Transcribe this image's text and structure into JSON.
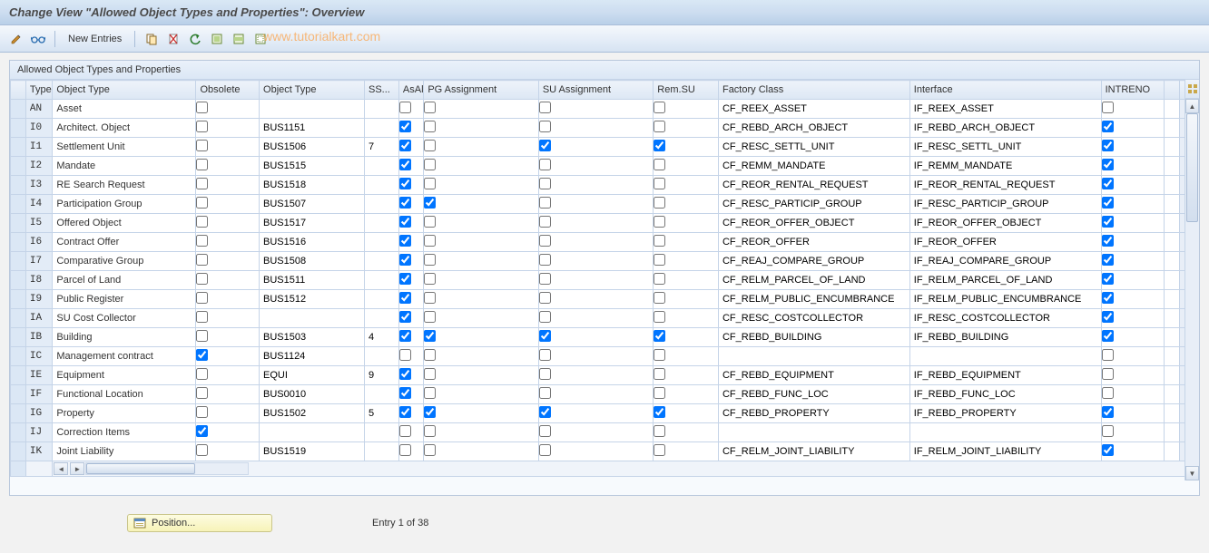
{
  "title": "Change View \"Allowed Object Types and Properties\": Overview",
  "watermark": "www.tutorialkart.com",
  "toolbar": {
    "new_entries": "New Entries"
  },
  "panel": {
    "header": "Allowed Object Types and Properties"
  },
  "columns": {
    "type": "Type",
    "object_type": "Object Type",
    "obsolete": "Obsolete",
    "object_type2": "Object Type",
    "ss": "SS...",
    "asal": "AsAl",
    "pg": "PG Assignment",
    "su": "SU Assignment",
    "remsu": "Rem.SU",
    "factory": "Factory Class",
    "interface": "Interface",
    "intreno": "INTRENO"
  },
  "rows": [
    {
      "type": "AN",
      "name": "Asset",
      "obsolete": false,
      "bus": "",
      "ss": "",
      "asal": false,
      "pg": false,
      "su": false,
      "remsu": false,
      "factory": "CF_REEX_ASSET",
      "iface": "IF_REEX_ASSET",
      "intreno": false
    },
    {
      "type": "I0",
      "name": "Architect. Object",
      "obsolete": false,
      "bus": "BUS1151",
      "ss": "",
      "asal": true,
      "pg": false,
      "su": false,
      "remsu": false,
      "factory": "CF_REBD_ARCH_OBJECT",
      "iface": "IF_REBD_ARCH_OBJECT",
      "intreno": true
    },
    {
      "type": "I1",
      "name": "Settlement Unit",
      "obsolete": false,
      "bus": "BUS1506",
      "ss": "7",
      "asal": true,
      "pg": false,
      "su": true,
      "remsu": true,
      "factory": "CF_RESC_SETTL_UNIT",
      "iface": "IF_RESC_SETTL_UNIT",
      "intreno": true
    },
    {
      "type": "I2",
      "name": "Mandate",
      "obsolete": false,
      "bus": "BUS1515",
      "ss": "",
      "asal": true,
      "pg": false,
      "su": false,
      "remsu": false,
      "factory": "CF_REMM_MANDATE",
      "iface": "IF_REMM_MANDATE",
      "intreno": true
    },
    {
      "type": "I3",
      "name": "RE Search Request",
      "obsolete": false,
      "bus": "BUS1518",
      "ss": "",
      "asal": true,
      "pg": false,
      "su": false,
      "remsu": false,
      "factory": "CF_REOR_RENTAL_REQUEST",
      "iface": "IF_REOR_RENTAL_REQUEST",
      "intreno": true
    },
    {
      "type": "I4",
      "name": "Participation Group",
      "obsolete": false,
      "bus": "BUS1507",
      "ss": "",
      "asal": true,
      "pg": true,
      "su": false,
      "remsu": false,
      "factory": "CF_RESC_PARTICIP_GROUP",
      "iface": "IF_RESC_PARTICIP_GROUP",
      "intreno": true
    },
    {
      "type": "I5",
      "name": "Offered Object",
      "obsolete": false,
      "bus": "BUS1517",
      "ss": "",
      "asal": true,
      "pg": false,
      "su": false,
      "remsu": false,
      "factory": "CF_REOR_OFFER_OBJECT",
      "iface": "IF_REOR_OFFER_OBJECT",
      "intreno": true
    },
    {
      "type": "I6",
      "name": "Contract Offer",
      "obsolete": false,
      "bus": "BUS1516",
      "ss": "",
      "asal": true,
      "pg": false,
      "su": false,
      "remsu": false,
      "factory": "CF_REOR_OFFER",
      "iface": "IF_REOR_OFFER",
      "intreno": true
    },
    {
      "type": "I7",
      "name": "Comparative Group",
      "obsolete": false,
      "bus": "BUS1508",
      "ss": "",
      "asal": true,
      "pg": false,
      "su": false,
      "remsu": false,
      "factory": "CF_REAJ_COMPARE_GROUP",
      "iface": "IF_REAJ_COMPARE_GROUP",
      "intreno": true
    },
    {
      "type": "I8",
      "name": "Parcel of Land",
      "obsolete": false,
      "bus": "BUS1511",
      "ss": "",
      "asal": true,
      "pg": false,
      "su": false,
      "remsu": false,
      "factory": "CF_RELM_PARCEL_OF_LAND",
      "iface": "IF_RELM_PARCEL_OF_LAND",
      "intreno": true
    },
    {
      "type": "I9",
      "name": "Public Register",
      "obsolete": false,
      "bus": "BUS1512",
      "ss": "",
      "asal": true,
      "pg": false,
      "su": false,
      "remsu": false,
      "factory": "CF_RELM_PUBLIC_ENCUMBRANCE",
      "iface": "IF_RELM_PUBLIC_ENCUMBRANCE",
      "intreno": true
    },
    {
      "type": "IA",
      "name": "SU Cost Collector",
      "obsolete": false,
      "bus": "",
      "ss": "",
      "asal": true,
      "pg": false,
      "su": false,
      "remsu": false,
      "factory": "CF_RESC_COSTCOLLECTOR",
      "iface": "IF_RESC_COSTCOLLECTOR",
      "intreno": true
    },
    {
      "type": "IB",
      "name": "Building",
      "obsolete": false,
      "bus": "BUS1503",
      "ss": "4",
      "asal": true,
      "pg": true,
      "su": true,
      "remsu": true,
      "factory": "CF_REBD_BUILDING",
      "iface": "IF_REBD_BUILDING",
      "intreno": true
    },
    {
      "type": "IC",
      "name": "Management contract",
      "obsolete": true,
      "bus": "BUS1124",
      "ss": "",
      "asal": false,
      "pg": false,
      "su": false,
      "remsu": false,
      "factory": "",
      "iface": "",
      "intreno": false
    },
    {
      "type": "IE",
      "name": "Equipment",
      "obsolete": false,
      "bus": "EQUI",
      "ss": "9",
      "asal": true,
      "pg": false,
      "su": false,
      "remsu": false,
      "factory": "CF_REBD_EQUIPMENT",
      "iface": "IF_REBD_EQUIPMENT",
      "intreno": false
    },
    {
      "type": "IF",
      "name": "Functional Location",
      "obsolete": false,
      "bus": "BUS0010",
      "ss": "",
      "asal": true,
      "pg": false,
      "su": false,
      "remsu": false,
      "factory": "CF_REBD_FUNC_LOC",
      "iface": "IF_REBD_FUNC_LOC",
      "intreno": false
    },
    {
      "type": "IG",
      "name": "Property",
      "obsolete": false,
      "bus": "BUS1502",
      "ss": "5",
      "asal": true,
      "pg": true,
      "su": true,
      "remsu": true,
      "factory": "CF_REBD_PROPERTY",
      "iface": "IF_REBD_PROPERTY",
      "intreno": true
    },
    {
      "type": "IJ",
      "name": "Correction Items",
      "obsolete": true,
      "bus": "",
      "ss": "",
      "asal": false,
      "pg": false,
      "su": false,
      "remsu": false,
      "factory": "",
      "iface": "",
      "intreno": false
    },
    {
      "type": "IK",
      "name": "Joint Liability",
      "obsolete": false,
      "bus": "BUS1519",
      "ss": "",
      "asal": false,
      "pg": false,
      "su": false,
      "remsu": false,
      "factory": "CF_RELM_JOINT_LIABILITY",
      "iface": "IF_RELM_JOINT_LIABILITY",
      "intreno": true
    }
  ],
  "footer": {
    "position": "Position...",
    "entry": "Entry 1 of 38"
  }
}
